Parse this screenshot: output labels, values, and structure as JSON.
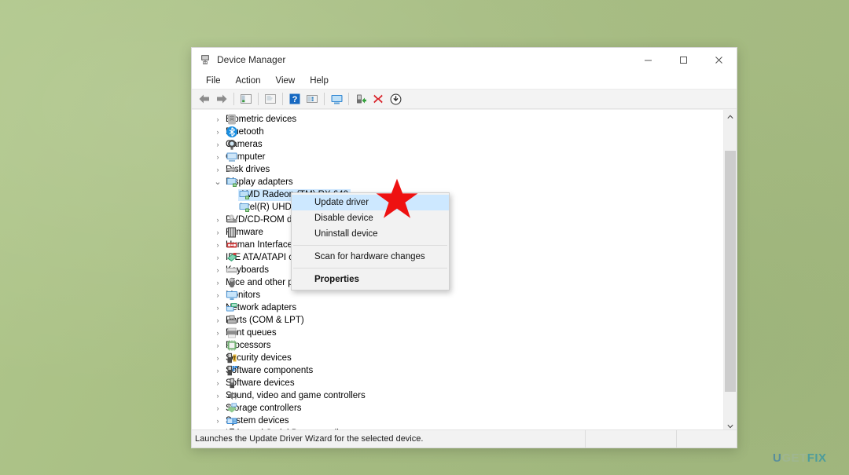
{
  "desktop": {
    "background_color": "#a9bf86",
    "watermark": {
      "part1": "U",
      "part2": "GET",
      "part3": "FIX"
    }
  },
  "window": {
    "title": "Device Manager",
    "title_icon": "device-manager-icon",
    "caption": {
      "minimize": "─",
      "maximize": "☐",
      "close": "✕"
    },
    "menubar": [
      {
        "label": "File"
      },
      {
        "label": "Action"
      },
      {
        "label": "View"
      },
      {
        "label": "Help"
      }
    ],
    "toolbar": [
      {
        "name": "back-icon"
      },
      {
        "name": "forward-icon"
      },
      {
        "sep": true
      },
      {
        "name": "show-hide-console-tree-icon"
      },
      {
        "sep": true
      },
      {
        "name": "properties-icon"
      },
      {
        "sep": true
      },
      {
        "name": "help-icon"
      },
      {
        "name": "update-driver-icon"
      },
      {
        "sep": true
      },
      {
        "name": "scan-for-hardware-changes-icon"
      },
      {
        "sep": true
      },
      {
        "name": "enable-device-icon"
      },
      {
        "name": "uninstall-device-icon"
      },
      {
        "name": "download-icon"
      }
    ]
  },
  "tree": {
    "items": [
      {
        "label": "Biometric devices",
        "level": 1,
        "expanded": false,
        "icon": "biometric-device-icon",
        "selected": false
      },
      {
        "label": "Bluetooth",
        "level": 1,
        "expanded": false,
        "icon": "bluetooth-icon",
        "selected": false
      },
      {
        "label": "Cameras",
        "level": 1,
        "expanded": false,
        "icon": "camera-icon",
        "selected": false
      },
      {
        "label": "Computer",
        "level": 1,
        "expanded": false,
        "icon": "computer-icon",
        "selected": false
      },
      {
        "label": "Disk drives",
        "level": 1,
        "expanded": false,
        "icon": "disk-drive-icon",
        "selected": false
      },
      {
        "label": "Display adapters",
        "level": 1,
        "expanded": true,
        "icon": "display-adapter-icon",
        "selected": false
      },
      {
        "label": "AMD Radeon (TM) RX 640",
        "level": 2,
        "expanded": null,
        "icon": "display-adapter-icon",
        "selected": true
      },
      {
        "label": "Intel(R) UHD Graphics",
        "level": 2,
        "expanded": null,
        "icon": "display-adapter-icon",
        "selected": false
      },
      {
        "label": "DVD/CD-ROM drives",
        "level": 1,
        "expanded": false,
        "icon": "dvd-drive-icon",
        "selected": false
      },
      {
        "label": "Firmware",
        "level": 1,
        "expanded": false,
        "icon": "firmware-icon",
        "selected": false
      },
      {
        "label": "Human Interface Devices",
        "level": 1,
        "expanded": false,
        "icon": "hid-icon",
        "selected": false
      },
      {
        "label": "IDE ATA/ATAPI controllers",
        "level": 1,
        "expanded": false,
        "icon": "ide-controller-icon",
        "selected": false
      },
      {
        "label": "Keyboards",
        "level": 1,
        "expanded": false,
        "icon": "keyboard-icon",
        "selected": false
      },
      {
        "label": "Mice and other pointing devices",
        "level": 1,
        "expanded": false,
        "icon": "mouse-icon",
        "selected": false
      },
      {
        "label": "Monitors",
        "level": 1,
        "expanded": false,
        "icon": "monitor-icon",
        "selected": false
      },
      {
        "label": "Network adapters",
        "level": 1,
        "expanded": false,
        "icon": "network-adapter-icon",
        "selected": false
      },
      {
        "label": "Ports (COM & LPT)",
        "level": 1,
        "expanded": false,
        "icon": "port-icon",
        "selected": false
      },
      {
        "label": "Print queues",
        "level": 1,
        "expanded": false,
        "icon": "printer-icon",
        "selected": false
      },
      {
        "label": "Processors",
        "level": 1,
        "expanded": false,
        "icon": "processor-icon",
        "selected": false
      },
      {
        "label": "Security devices",
        "level": 1,
        "expanded": false,
        "icon": "security-device-icon",
        "selected": false
      },
      {
        "label": "Software components",
        "level": 1,
        "expanded": false,
        "icon": "software-component-icon",
        "selected": false
      },
      {
        "label": "Software devices",
        "level": 1,
        "expanded": false,
        "icon": "software-device-icon",
        "selected": false
      },
      {
        "label": "Sound, video and game controllers",
        "level": 1,
        "expanded": false,
        "icon": "sound-controller-icon",
        "selected": false
      },
      {
        "label": "Storage controllers",
        "level": 1,
        "expanded": false,
        "icon": "storage-controller-icon",
        "selected": false
      },
      {
        "label": "System devices",
        "level": 1,
        "expanded": false,
        "icon": "system-device-icon",
        "selected": false
      },
      {
        "label": "Universal Serial Bus controllers",
        "level": 1,
        "expanded": false,
        "icon": "usb-controller-icon",
        "selected": false
      }
    ],
    "chevron_collapsed": "›",
    "chevron_expanded": "⌄"
  },
  "context_menu": {
    "items": [
      {
        "label": "Update driver",
        "highlight": true,
        "bold": false,
        "separator_after": false
      },
      {
        "label": "Disable device",
        "highlight": false,
        "bold": false,
        "separator_after": false
      },
      {
        "label": "Uninstall device",
        "highlight": false,
        "bold": false,
        "separator_after": true
      },
      {
        "label": "Scan for hardware changes",
        "highlight": false,
        "bold": false,
        "separator_after": true
      },
      {
        "label": "Properties",
        "highlight": false,
        "bold": true,
        "separator_after": false
      }
    ]
  },
  "statusbar": {
    "message": "Launches the Update Driver Wizard for the selected device."
  },
  "annotation": {
    "marker": "red-star-marker",
    "color": "#ee1111"
  },
  "scrollbar": {
    "up_arrow": "▲",
    "down_arrow": "▼"
  }
}
